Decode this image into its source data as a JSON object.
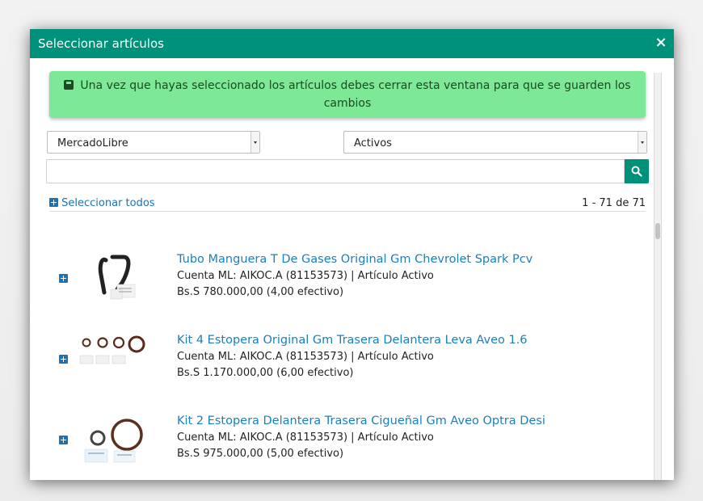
{
  "modal": {
    "title": "Seleccionar artículos",
    "close_label": "×"
  },
  "alert": {
    "icon": "save-icon",
    "text": "Una vez que hayas seleccionado los artículos debes cerrar esta ventana para que se guarden los cambios"
  },
  "filters": {
    "source_selected": "MercadoLibre",
    "status_selected": "Activos"
  },
  "search": {
    "value": "",
    "placeholder": ""
  },
  "list_header": {
    "select_all_label": "Seleccionar todos",
    "counter": "1 - 71 de 71"
  },
  "items": [
    {
      "title": "Tubo Manguera T De Gases Original Gm Chevrolet Spark Pcv",
      "account": "Cuenta ML: AIKOC.A (81153573) | Artículo Activo",
      "price": "Bs.S 780.000,00 (4,00 efectivo)"
    },
    {
      "title": "Kit 4 Estopera Original Gm Trasera Delantera Leva Aveo 1.6",
      "account": "Cuenta ML: AIKOC.A (81153573) | Artículo Activo",
      "price": "Bs.S 1.170.000,00 (6,00 efectivo)"
    },
    {
      "title": "Kit 2 Estopera Delantera Trasera Cigueñal Gm Aveo Optra Desi",
      "account": "Cuenta ML: AIKOC.A (81153573) | Artículo Activo",
      "price": "Bs.S 975.000,00 (5,00 efectivo)"
    }
  ],
  "colors": {
    "header": "#00917a",
    "alert_bg": "#7de895",
    "link": "#1a7fc0"
  }
}
